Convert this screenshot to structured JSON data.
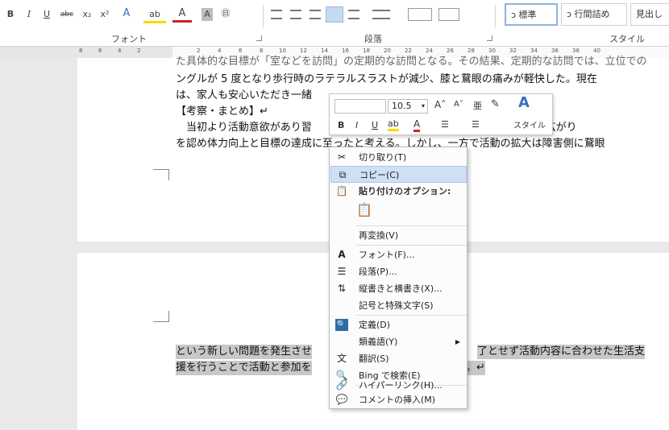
{
  "ribbon": {
    "font_buttons": [
      "B",
      "I",
      "U",
      "abc",
      "x₂",
      "x²",
      "A",
      "ab",
      "A",
      "A",
      "㊐"
    ],
    "font_group_label": "フォント",
    "paragraph_group_label": "段落",
    "style_group_label": "スタイル",
    "styles": [
      "ↄ 標準",
      "ↄ 行間詰め",
      "見出し"
    ]
  },
  "ruler": {
    "ticks": [
      "8",
      "6",
      "4",
      "2",
      "2",
      "4",
      "6",
      "8",
      "10",
      "12",
      "14",
      "16",
      "18",
      "20",
      "22",
      "24",
      "26",
      "28",
      "30",
      "32",
      "34",
      "36",
      "38",
      "40"
    ]
  },
  "document": {
    "page1_lines": [
      "た具体的な目標が「室などを訪問」の定期的な訪問となる。その結果、定期的な訪問では、立位での",
      "ングルが 5 度となり歩行時のラテラルスラストが減少、膝と鵞眼の痛みが軽快した。現在",
      "は、家人も安心いただき一緒",
      "【考察・まとめ】↵",
      "　当初より活動意欲があり習",
      "を認め体力向上と目標の達成に至ったと考える。しかし、一方で活動の拡大は障害側に鵞眼"
    ],
    "page1_right_fragment": "言となり活動の広がり",
    "page2_lines": [
      "という新しい問題を発生させ",
      "援を行うことで活動と参加を"
    ],
    "page2_right_fragments": [
      "了とせず活動内容に合わせた生活支",
      "。↵"
    ]
  },
  "mini_toolbar": {
    "font_size": "10.5",
    "grow_font": "A˄",
    "shrink_font": "A˅",
    "phonetic": "亜",
    "format_painter": "✎",
    "styles_label": "スタイル",
    "bold": "B",
    "italic": "I",
    "underline": "U",
    "highlight": "ab",
    "font_color": "A",
    "bullets": "☰",
    "numbering": "☰",
    "dropdown": "▾"
  },
  "context_menu": {
    "cut": "切り取り(T)",
    "copy": "コピー(C)",
    "paste_options": "貼り付けのオプション:",
    "reconvert": "再変換(V)",
    "font": "フォント(F)...",
    "paragraph": "段落(P)...",
    "text_direction": "縦書きと横書き(X)...",
    "symbols": "記号と特殊文字(S)",
    "define": "定義(D)",
    "synonyms": "類義語(Y)",
    "translate": "翻訳(S)",
    "bing_search": "Bing で検索(E)",
    "hyperlink": "ハイパーリンク(H)...",
    "insert_comment": "コメントの挿入(M)",
    "submenu_arrow": "▶"
  },
  "colors": {
    "menu_hover": "#cfe0f5",
    "selection_highlight": "#c8c8c8",
    "style_active_border": "#8fb3e0",
    "highlight_yellow": "#ffd700",
    "font_red": "#d02020",
    "styles_blue": "#3a6fc4"
  }
}
